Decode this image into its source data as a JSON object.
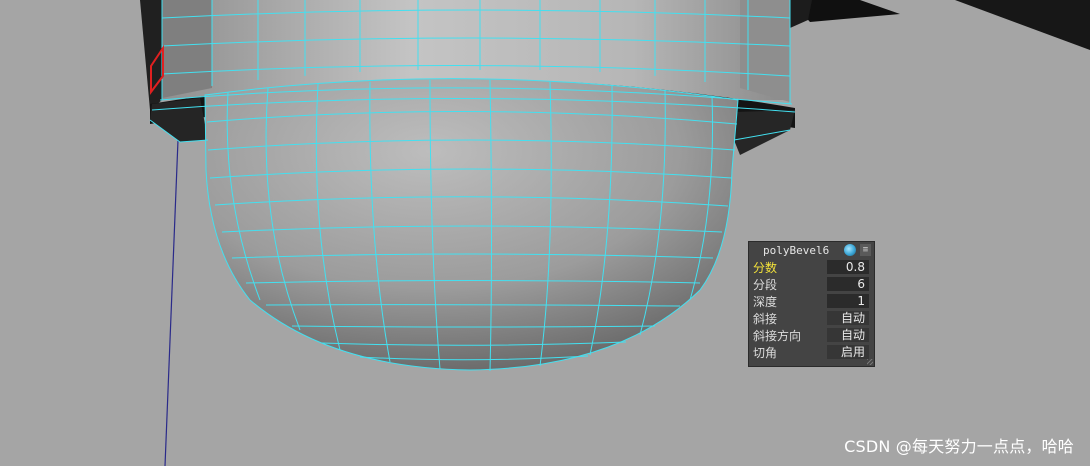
{
  "viewport": {
    "background_color": "#a5a5a5",
    "wireframe_color": "#43e0f0",
    "selected_edge_color": "#e02020",
    "grid_line_color": "#222299"
  },
  "bevel_editor": {
    "title": "polyBevel6",
    "title_icon": "globe-icon",
    "menu_icon": "menu-icon",
    "attributes": [
      {
        "label": "分数",
        "value": "0.8",
        "active": true
      },
      {
        "label": "分段",
        "value": "6",
        "active": false
      },
      {
        "label": "深度",
        "value": "1",
        "active": false
      },
      {
        "label": "斜接",
        "value": "自动",
        "active": false
      },
      {
        "label": "斜接方向",
        "value": "自动",
        "active": false
      },
      {
        "label": "切角",
        "value": "启用",
        "active": false
      }
    ]
  },
  "watermark": {
    "text": "CSDN @每天努力一点点，哈哈"
  }
}
